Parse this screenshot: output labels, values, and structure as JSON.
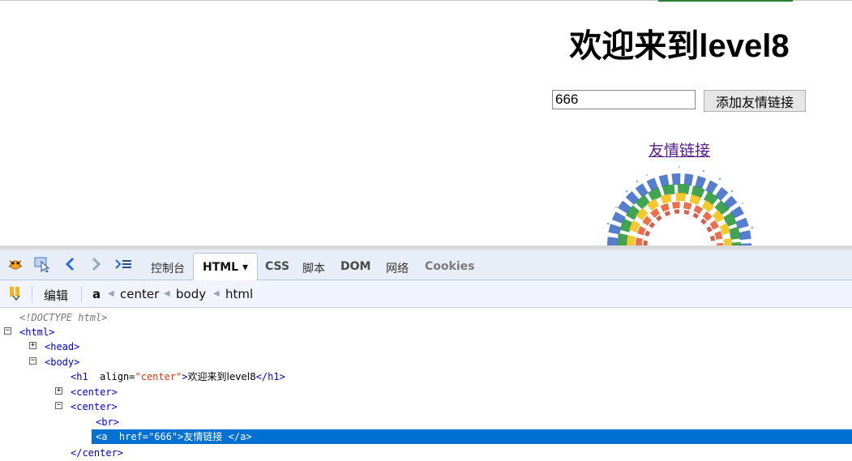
{
  "page": {
    "heading": "欢迎来到level8",
    "input_value": "666",
    "add_button_label": "添加友情链接",
    "link_text": "友情链接"
  },
  "devtools": {
    "tabs": {
      "console": "控制台",
      "html": "HTML ▾",
      "css": "CSS",
      "script": "脚本",
      "dom": "DOM",
      "net": "网络",
      "cookies": "Cookies"
    },
    "toolbar": {
      "edit_label": "编辑",
      "breadcrumbs": [
        "a",
        "center",
        "body",
        "html"
      ]
    },
    "tree": {
      "doctype": "<!DOCTYPE html>",
      "html_tag": "<html>",
      "head_tag": "<head>",
      "body_tag": "<body>",
      "h1_open": "<h1",
      "h1_attr_name": "align=",
      "h1_attr_value": "\"center\"",
      "h1_close_bracket": ">",
      "h1_text": "欢迎来到level8",
      "h1_end": "</h1>",
      "center1": "<center>",
      "center2": "<center>",
      "br": "<br>",
      "a_open": "<a",
      "a_attr_name": "href=",
      "a_attr_value": "\"666\"",
      "a_close_bracket": ">",
      "a_text": "友情链接",
      "a_end": "</a>",
      "center_end": "</center>"
    }
  },
  "colors": {
    "tag": "#0000c8",
    "attr_value": "#e0340f",
    "selection": "#0070d3",
    "visited_link": "#551a8b"
  }
}
